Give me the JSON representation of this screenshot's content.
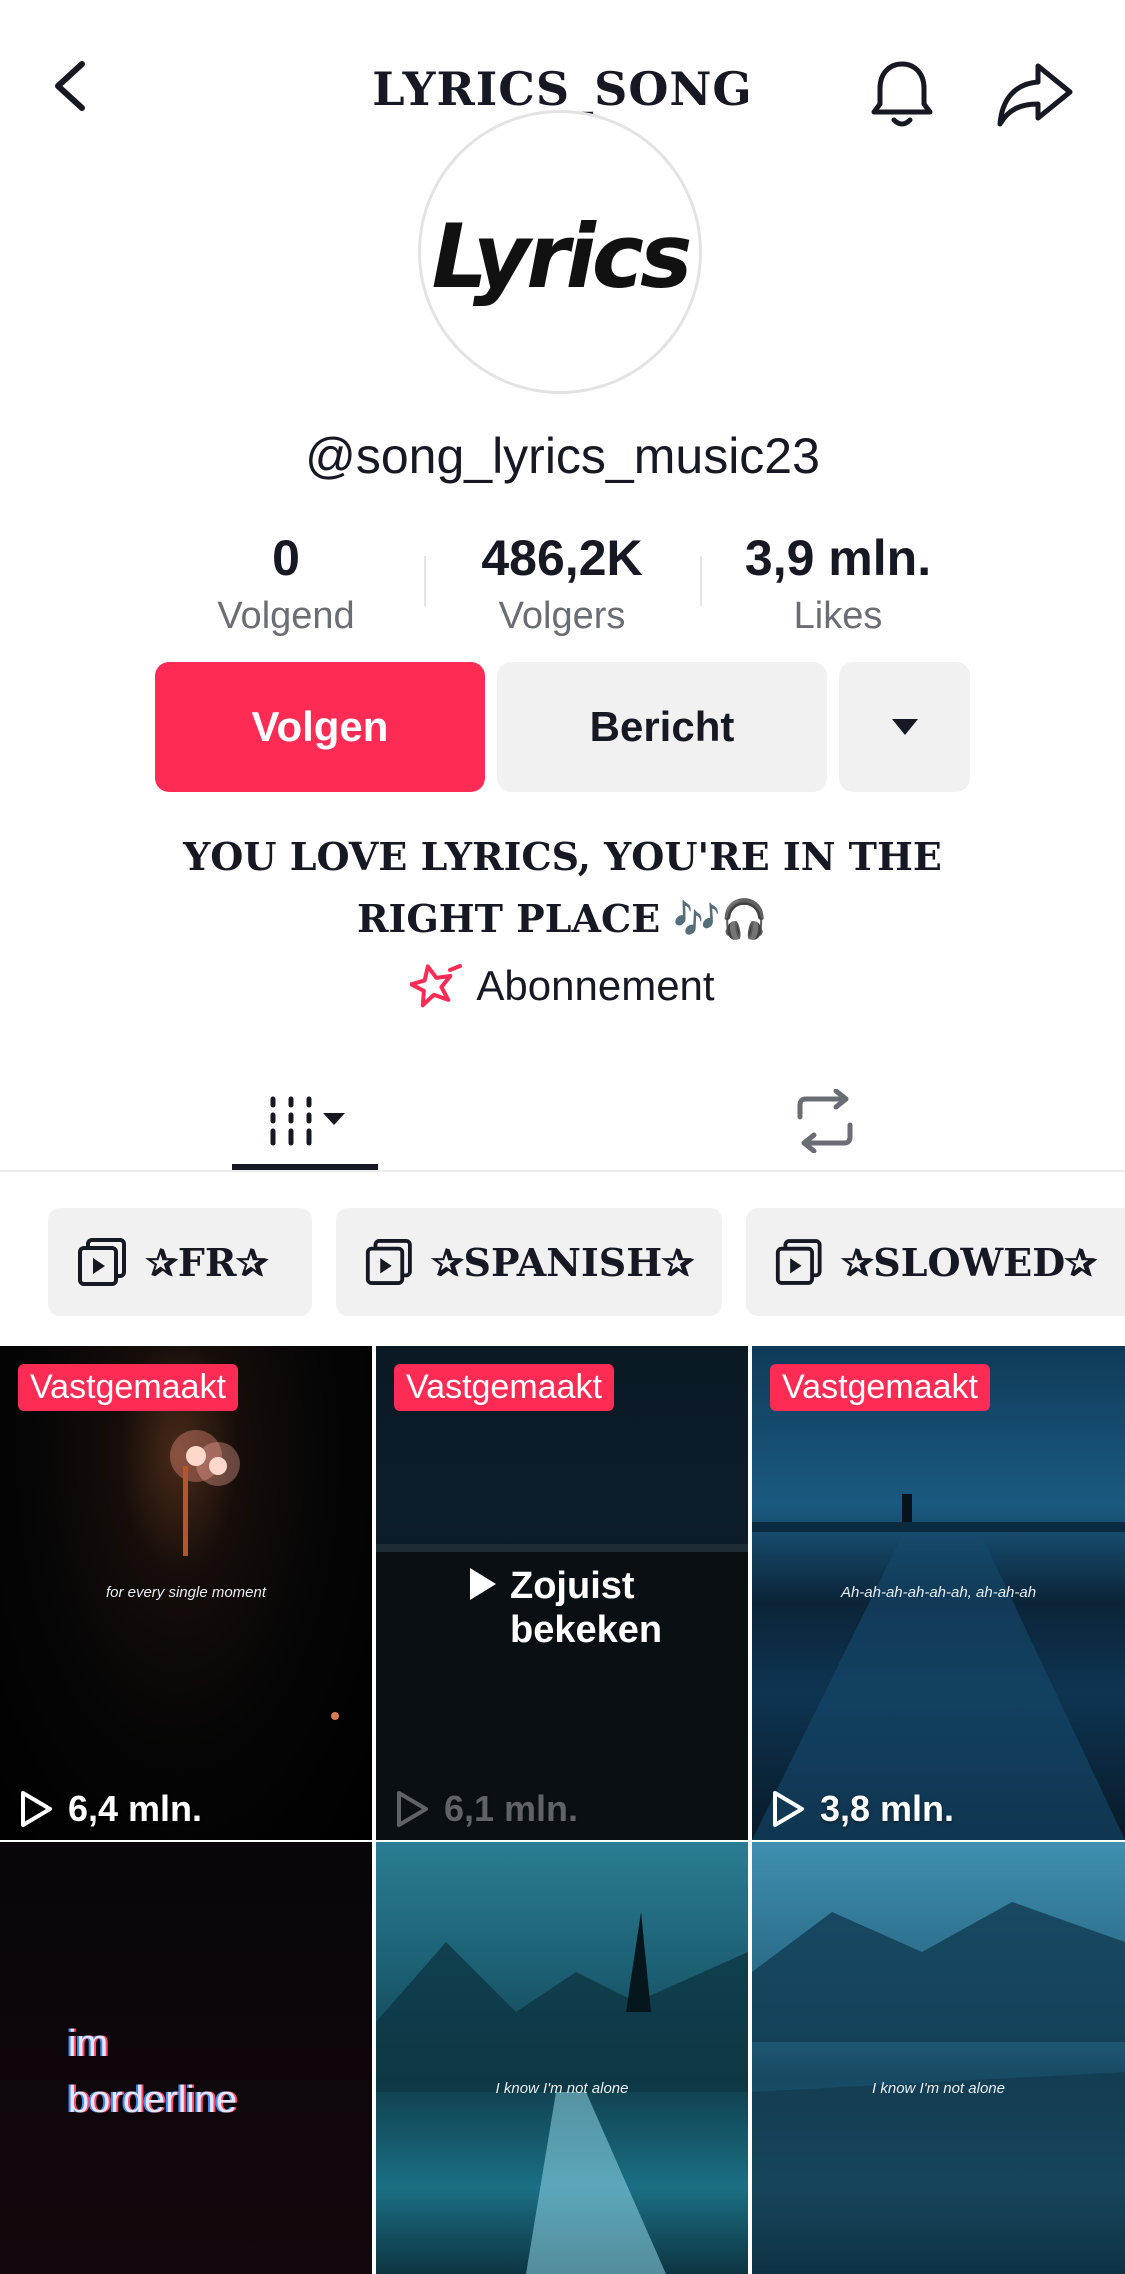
{
  "header": {
    "title": "LYRICS_SONG"
  },
  "profile": {
    "avatar_text": "Lyrics",
    "username": "@song_lyrics_music23",
    "stats": [
      {
        "value": "0",
        "label": "Volgend"
      },
      {
        "value": "486,2K",
        "label": "Volgers"
      },
      {
        "value": "3,9 mln.",
        "label": "Likes"
      }
    ],
    "buttons": {
      "follow": "Volgen",
      "message": "Bericht"
    },
    "bio_line1": "YOU LOVE LYRICS, YOU'RE IN THE",
    "bio_line2": "RIGHT PLACE 🎶🎧",
    "subscription": "Abonnement"
  },
  "playlists": [
    {
      "label": "✰FR✰"
    },
    {
      "label": "✰SPANISH✰"
    },
    {
      "label": "✰SLOWED✰"
    }
  ],
  "videos": [
    {
      "pinned": "Vastgemaakt",
      "views": "6,4 mln.",
      "caption": "for every single moment"
    },
    {
      "pinned": "Vastgemaakt",
      "views": "6,1 mln.",
      "overlay": "Zojuist bekeken",
      "overlay_line1": "Zojuist",
      "overlay_line2": "bekeken"
    },
    {
      "pinned": "Vastgemaakt",
      "views": "3,8 mln.",
      "caption": "Ah-ah-ah-ah-ah-ah, ah-ah-ah"
    },
    {
      "caption_line1": "im",
      "caption_line2": "borderline"
    },
    {
      "caption": "I know I'm not alone"
    },
    {
      "caption": "I know I'm not alone"
    }
  ],
  "colors": {
    "accent": "#fe2c55",
    "button_gray": "#f1f1f2",
    "text": "#161823"
  }
}
